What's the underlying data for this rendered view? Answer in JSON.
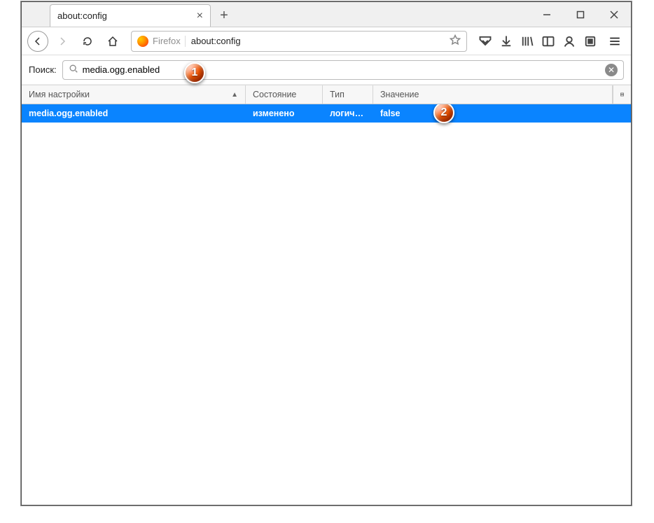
{
  "tab": {
    "title": "about:config"
  },
  "urlbar": {
    "identity": "Firefox",
    "url": "about:config"
  },
  "search": {
    "label": "Поиск:",
    "value": "media.ogg.enabled"
  },
  "columns": {
    "name": "Имя настройки",
    "state": "Состояние",
    "type": "Тип",
    "value": "Значение"
  },
  "row": {
    "name": "media.ogg.enabled",
    "state": "изменено",
    "type": "логичес...",
    "value": "false"
  },
  "bubble1": "1",
  "bubble2": "2"
}
